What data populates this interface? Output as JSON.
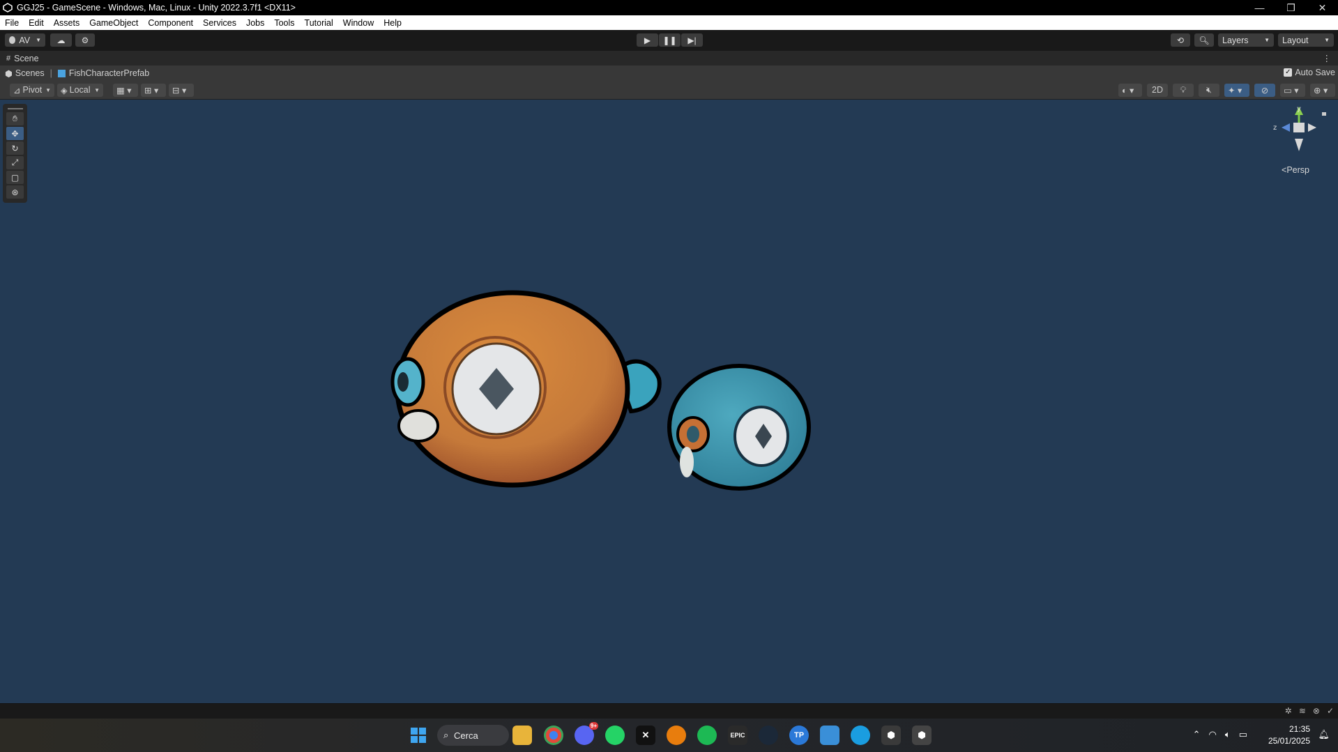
{
  "window": {
    "title": "GGJ25 - GameScene - Windows, Mac, Linux - Unity 2022.3.7f1 <DX11>"
  },
  "menu": [
    "File",
    "Edit",
    "Assets",
    "GameObject",
    "Component",
    "Services",
    "Jobs",
    "Tools",
    "Tutorial",
    "Window",
    "Help"
  ],
  "toolbar": {
    "account_label": "AV",
    "layers_label": "Layers",
    "layout_label": "Layout"
  },
  "scene_tab": {
    "label": "Scene"
  },
  "breadcrumb": {
    "root": "Scenes",
    "prefab": "FishCharacterPrefab",
    "autosave_label": "Auto Save"
  },
  "scene_toolbar": {
    "pivot_label": "Pivot",
    "local_label": "Local",
    "twod_label": "2D"
  },
  "gizmo": {
    "y_label": "y",
    "z_label": "z",
    "persp_label": "Persp"
  },
  "taskbar": {
    "search_label": "Cerca",
    "time": "21:35",
    "date": "25/01/2025",
    "discord_badge": "9+"
  },
  "colors": {
    "viewport_bg": "#233a54",
    "accent": "#3b5d84"
  }
}
